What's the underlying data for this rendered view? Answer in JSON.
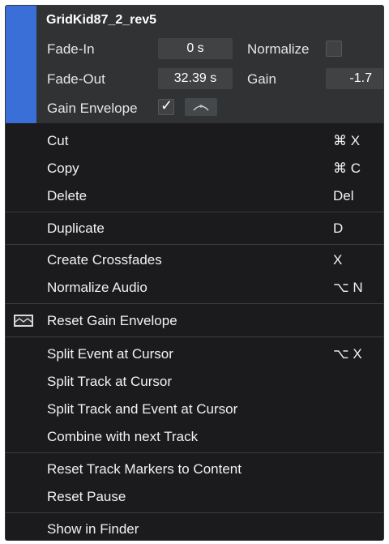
{
  "header": {
    "event_name": "GridKid87_2_rev5",
    "fade_in_label": "Fade-In",
    "fade_in_value": "0 s",
    "normalize_label": "Normalize",
    "normalize_checked": false,
    "fade_out_label": "Fade-Out",
    "fade_out_value": "32.39 s",
    "gain_label": "Gain",
    "gain_value": "-1.7",
    "gain_envelope_label": "Gain Envelope",
    "gain_envelope_checked": true,
    "accent_color": "#3a6fd8"
  },
  "items": [
    {
      "label": "Cut",
      "shortcut": "⌘ X"
    },
    {
      "label": "Copy",
      "shortcut": "⌘ C"
    },
    {
      "label": "Delete",
      "shortcut": "Del"
    },
    {
      "label": "Duplicate",
      "shortcut": "D"
    },
    {
      "label": "Create Crossfades",
      "shortcut": "X"
    },
    {
      "label": "Normalize Audio",
      "shortcut": "⌥ N"
    },
    {
      "label": "Reset Gain Envelope",
      "shortcut": "",
      "icon": "gain-envelope-icon"
    },
    {
      "label": "Split Event at Cursor",
      "shortcut": "⌥ X"
    },
    {
      "label": "Split Track at Cursor",
      "shortcut": ""
    },
    {
      "label": "Split Track and Event at Cursor",
      "shortcut": ""
    },
    {
      "label": "Combine with next Track",
      "shortcut": ""
    },
    {
      "label": "Reset Track Markers to Content",
      "shortcut": ""
    },
    {
      "label": "Reset Pause",
      "shortcut": ""
    },
    {
      "label": "Show in Finder",
      "shortcut": ""
    }
  ]
}
